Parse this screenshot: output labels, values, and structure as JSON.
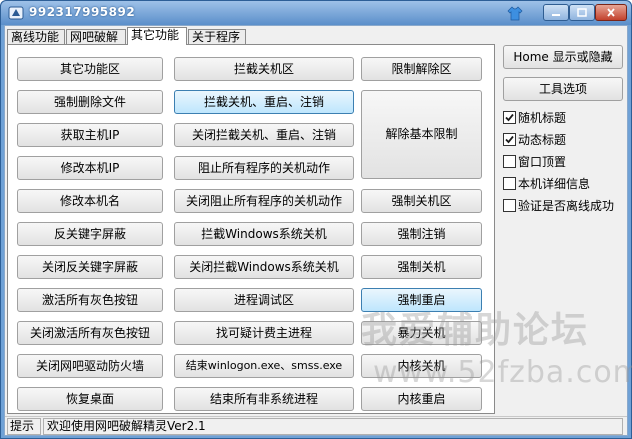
{
  "window": {
    "title": "992317995892"
  },
  "tabs": [
    {
      "label": "离线功能"
    },
    {
      "label": "网吧破解"
    },
    {
      "label": "其它功能"
    },
    {
      "label": "关于程序"
    }
  ],
  "col1": [
    "其它功能区",
    "强制删除文件",
    "获取主机IP",
    "修改本机IP",
    "修改本机名",
    "反关键字屏蔽",
    "关闭反关键字屏蔽",
    "激活所有灰色按钮",
    "关闭激活所有灰色按钮",
    "关闭网吧驱动防火墙",
    "恢复桌面"
  ],
  "col2": [
    "拦截关机区",
    "拦截关机、重启、注销",
    "关闭拦截关机、重启、注销",
    "阻止所有程序的关机动作",
    "关闭阻止所有程序的关机动作",
    "拦截Windows系统关机",
    "关闭拦截Windows系统关机",
    "进程调试区",
    "找可疑计费主进程",
    "结束winlogon.exe、smss.exe",
    "结束所有非系统进程"
  ],
  "col3": {
    "limit_header": "限制解除区",
    "unlock_basic": "解除基本限制",
    "shutdown_header": "强制关机区",
    "items": [
      "强制注销",
      "强制关机",
      "强制重启",
      "暴力关机",
      "内核关机",
      "内核重启"
    ]
  },
  "side": {
    "home_toggle": "Home 显示或隐藏",
    "tools_label": "工具选项",
    "checkboxes": [
      {
        "label": "随机标题",
        "checked": true
      },
      {
        "label": "动态标题",
        "checked": true
      },
      {
        "label": "窗口顶置",
        "checked": false
      },
      {
        "label": "本机详细信息",
        "checked": false
      },
      {
        "label": "验证是否离线成功",
        "checked": false
      }
    ]
  },
  "status": {
    "label": "提示",
    "message": "欢迎使用网吧破解精灵Ver2.1"
  },
  "watermark": {
    "line1": "我爱辅助论坛",
    "line2": "www.52fzba.com"
  }
}
